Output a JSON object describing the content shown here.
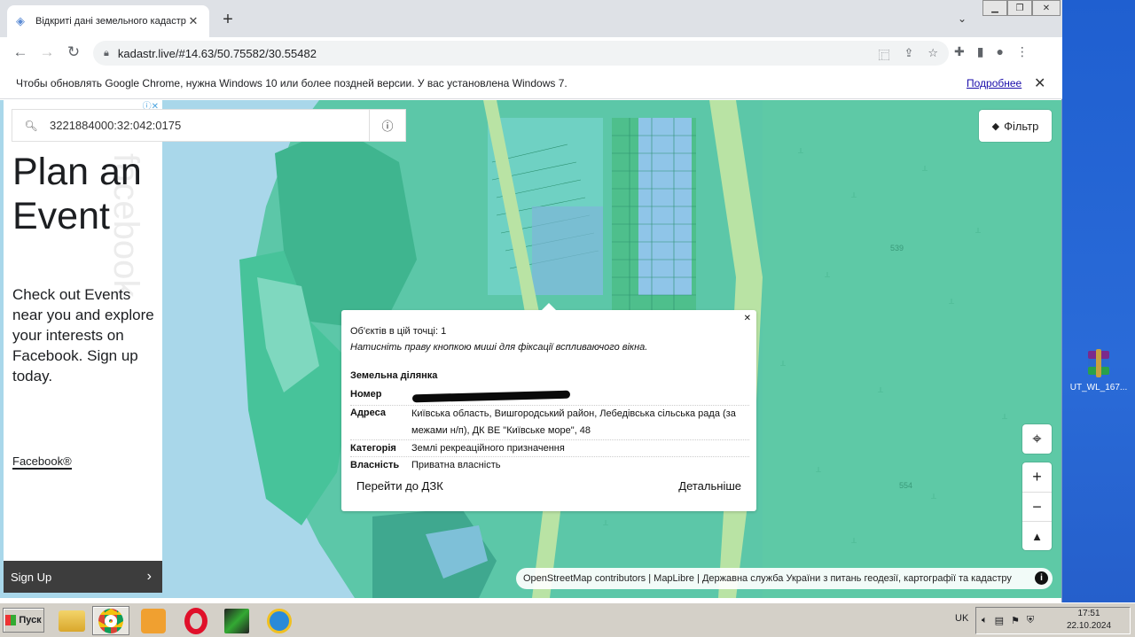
{
  "browser": {
    "tab_title": "Відкриті дані земельного кадастру",
    "new_tab": "+",
    "url": "kadastr.live/#14.63/50.75582/30.55482",
    "infobar_text": "Чтобы обновлять Google Chrome, нужна Windows 10 или более поздней версии. У вас установлена Windows 7.",
    "infobar_link": "Подробнее"
  },
  "ad": {
    "headline": "Plan an Event",
    "body": "Check out Events near you and explore your interests on Facebook. Sign up today.",
    "brand": "Facebook®",
    "watermark": "facebook",
    "cta": "Sign Up"
  },
  "search": {
    "value": "3221884000:32:042:0175"
  },
  "filter": {
    "label": "Фільтр"
  },
  "popup": {
    "objects_count": "Об'єктів в цій точці: 1",
    "hint": "Натисніть праву кнопкою миші для фіксації вспливаючого вікна.",
    "section": "Земельна ділянка",
    "fields": {
      "number_label": "Номер",
      "address_label": "Адреса",
      "address_value": "Київська область, Вишгородський район, Лебедівська сільська рада (за межами н/п), ДК ВЕ \"Київське море\", 48",
      "category_label": "Категорія",
      "category_value": "Землі рекреаційного призначення",
      "ownership_label": "Власність",
      "ownership_value": "Приватна власність"
    },
    "goto_btn": "Перейти до ДЗК",
    "details_btn": "Детальніше"
  },
  "map": {
    "label_539": "539",
    "label_554": "554",
    "attribution": "OpenStreetMap contributors | MapLibre | Державна служба України з питань геодезії, картографії та кадастру"
  },
  "desktop": {
    "icon_label": "UT_WL_167..."
  },
  "taskbar": {
    "start": "Пуск",
    "lang": "UK",
    "time": "17:51",
    "date": "22.10.2024"
  }
}
